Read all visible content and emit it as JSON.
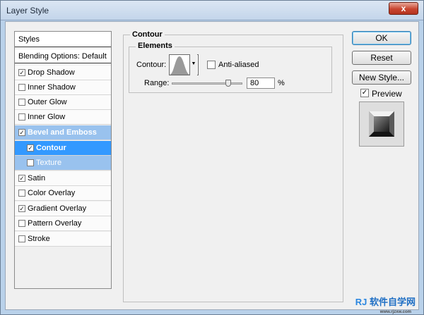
{
  "window": {
    "title": "Layer Style",
    "close_label": "x"
  },
  "styles_list": {
    "header": "Styles",
    "blending": "Blending Options: Default",
    "items": [
      {
        "label": "Drop Shadow",
        "checked": true
      },
      {
        "label": "Inner Shadow",
        "checked": false
      },
      {
        "label": "Outer Glow",
        "checked": false
      },
      {
        "label": "Inner Glow",
        "checked": false
      },
      {
        "label": "Bevel and Emboss",
        "checked": true
      },
      {
        "label": "Contour",
        "checked": true
      },
      {
        "label": "Texture",
        "checked": false
      },
      {
        "label": "Satin",
        "checked": true
      },
      {
        "label": "Color Overlay",
        "checked": false
      },
      {
        "label": "Gradient Overlay",
        "checked": true
      },
      {
        "label": "Pattern Overlay",
        "checked": false
      },
      {
        "label": "Stroke",
        "checked": false
      }
    ]
  },
  "contour_panel": {
    "title": "Contour",
    "elements_title": "Elements",
    "contour_label": "Contour:",
    "anti_aliased_label": "Anti-aliased",
    "range_label": "Range:",
    "range_value": "80",
    "range_unit": "%",
    "range_fraction": 0.8
  },
  "buttons": {
    "ok": "OK",
    "reset": "Reset",
    "new_style": "New Style...",
    "preview": "Preview"
  },
  "watermark": {
    "logo": "RJ",
    "text": "软件自学网",
    "url": "www.rjzxw.com"
  },
  "colors": {
    "selection": "#3399ff",
    "selection_light": "#99c2ee",
    "dialog_bg": "#f0f0f0",
    "watermark": "#1f6fc4"
  }
}
